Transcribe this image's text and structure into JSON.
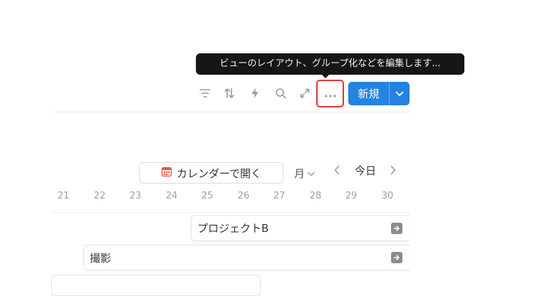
{
  "tooltip": {
    "text": "ビューのレイアウト、グループ化などを編集します..."
  },
  "toolbar": {
    "icons": [
      "filter-icon",
      "sort-icon",
      "automation-icon",
      "search-icon",
      "expand-icon",
      "more-icon"
    ],
    "new_label": "新規",
    "accent": "#2383e2",
    "highlight": "#e03636"
  },
  "calendar": {
    "open_label": "カレンダーで開く",
    "view_label": "月",
    "today_label": "今日",
    "prev_glyph": "‹",
    "next_glyph": "›",
    "days": [
      "21",
      "22",
      "23",
      "24",
      "25",
      "26",
      "27",
      "28",
      "29",
      "30"
    ]
  },
  "events": [
    {
      "title": "プロジェクトB"
    },
    {
      "title": "撮影"
    }
  ]
}
